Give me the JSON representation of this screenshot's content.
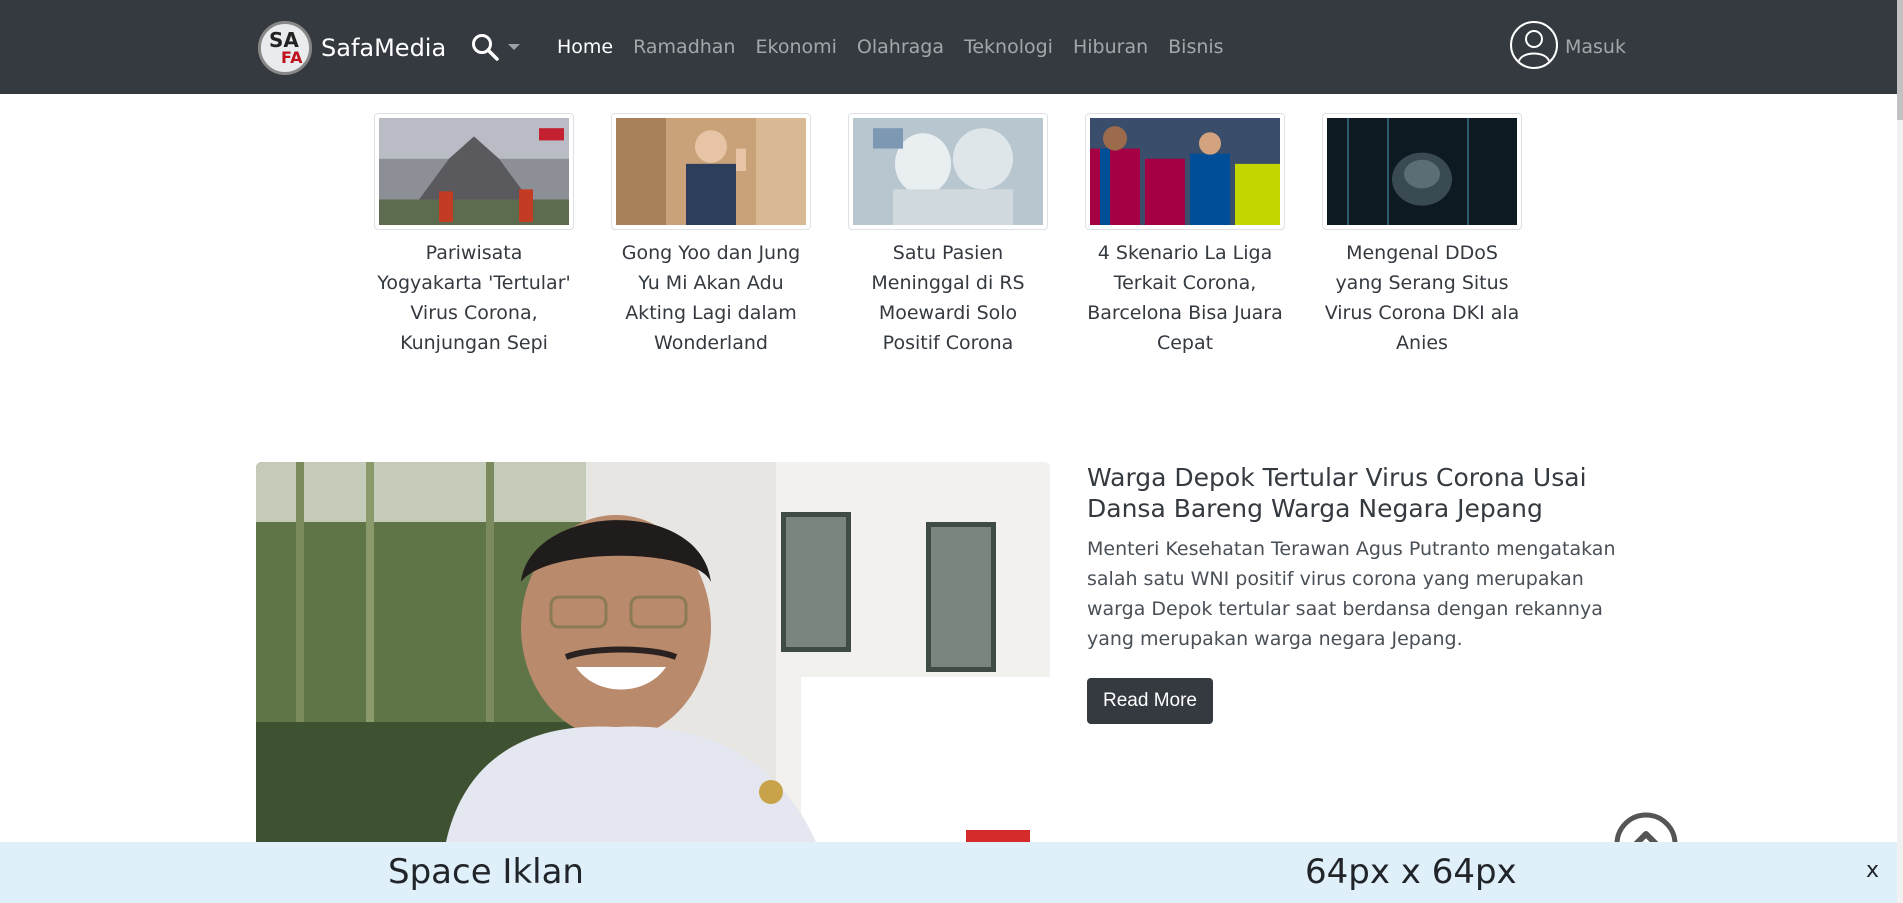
{
  "brand": {
    "name": "SafaMedia",
    "logo_text_top": "SA",
    "logo_text_bottom": "FA"
  },
  "search": {
    "icon": "search-icon",
    "dropdown_icon": "chevron-down-icon"
  },
  "nav": {
    "items": [
      {
        "label": "Home",
        "active": true
      },
      {
        "label": "Ramadhan"
      },
      {
        "label": "Ekonomi"
      },
      {
        "label": "Olahraga"
      },
      {
        "label": "Teknologi"
      },
      {
        "label": "Hiburan"
      },
      {
        "label": "Bisnis"
      }
    ]
  },
  "user": {
    "icon": "user-icon",
    "label": "Masuk"
  },
  "trending": [
    {
      "title": "Pariwisata Yogyakarta 'Tertular' Virus Corona, Kunjungan Sepi"
    },
    {
      "title": "Gong Yoo dan Jung Yu Mi Akan Adu Akting Lagi dalam Wonderland"
    },
    {
      "title": "Satu Pasien Meninggal di RS Moewardi Solo Positif Corona"
    },
    {
      "title": "4 Skenario La Liga Terkait Corona, Barcelona Bisa Juara Cepat"
    },
    {
      "title": "Mengenal DDoS yang Serang Situs Virus Corona DKI ala Anies"
    }
  ],
  "featured": {
    "title": "Warga Depok Tertular Virus Corona Usai Dansa Bareng Warga Negara Jepang",
    "excerpt": "Menteri Kesehatan Terawan Agus Putranto mengatakan salah satu WNI positif virus corona yang merupakan warga Depok tertular saat berdansa dengan rekannya yang merupakan warga negara Jepang.",
    "button_label": "Read More"
  },
  "scroll_top": {
    "icon": "chevron-up-circle-icon"
  },
  "ad": {
    "left_text": "Space Iklan",
    "right_text": "64px x 64px",
    "close_label": "x"
  },
  "colors": {
    "navbar": "#343a40",
    "ad_background": "#dff0fb",
    "button": "#343a40"
  }
}
